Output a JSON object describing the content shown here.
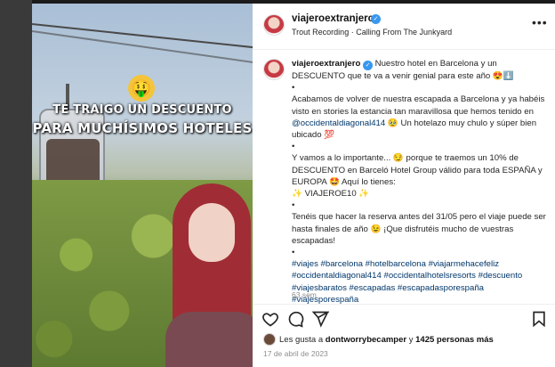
{
  "post": {
    "username": "viajeroextranjero",
    "music": "Trout Recording · Calling From The Junkyard",
    "more_icon": "more-icon"
  },
  "story_overlay": {
    "line1": "TE TRAIGO UN DESCUENTO",
    "line2": "PARA MUCHÍSIMOS HOTELES",
    "emoji": "🤑"
  },
  "caption": {
    "username": "viajeroextranjero",
    "intro": "Nuestro hotel en Barcelona y un DESCUENTO que te va a venir genial para este año 😍⬇️",
    "bullet": "•",
    "p1_before": "Acabamos de volver de nuestra escapada a Barcelona y ya habéis visto en stories la estancia tan maravillosa que hemos tenido en ",
    "p1_mention": "@occidentaldiagonal414",
    "p1_after": " 🥹 Un hotelazo muy chulo y súper bien ubicado 💯",
    "p2": "Y vamos a lo importante... 😏 porque te traemos un 10% de DESCUENTO en Barceló Hotel Group válido para toda ESPAÑA y EUROPA 🤩 Aquí lo tienes:",
    "code": "✨ VIAJEROE10 ✨",
    "p3": "Tenéis que hacer la reserva antes del 31/05 pero el viaje puede ser hasta finales de año 😉 ¡Que disfrutéis mucho de vuestras escapadas!",
    "hashtags": "#viajes #barcelona #hotelbarcelona #viajarmehacefeliz #occidentaldiagonal414 #occidentalhotelsresorts #descuento #viajesbaratos #escapadas #escapadasporespaña #viajesporespaña",
    "time_ago": "63 sem"
  },
  "likes": {
    "prefix": "Les gusta a ",
    "user": "dontworrybecamper",
    "middle": " y ",
    "count": "1425 personas más"
  },
  "date": "17 de abril de 2023",
  "icons": {
    "like": "heart-icon",
    "comment": "comment-icon",
    "share": "share-icon",
    "save": "bookmark-icon"
  },
  "colors": {
    "link": "#00376b",
    "verified": "#3897f0",
    "muted": "#8e8e8e"
  }
}
